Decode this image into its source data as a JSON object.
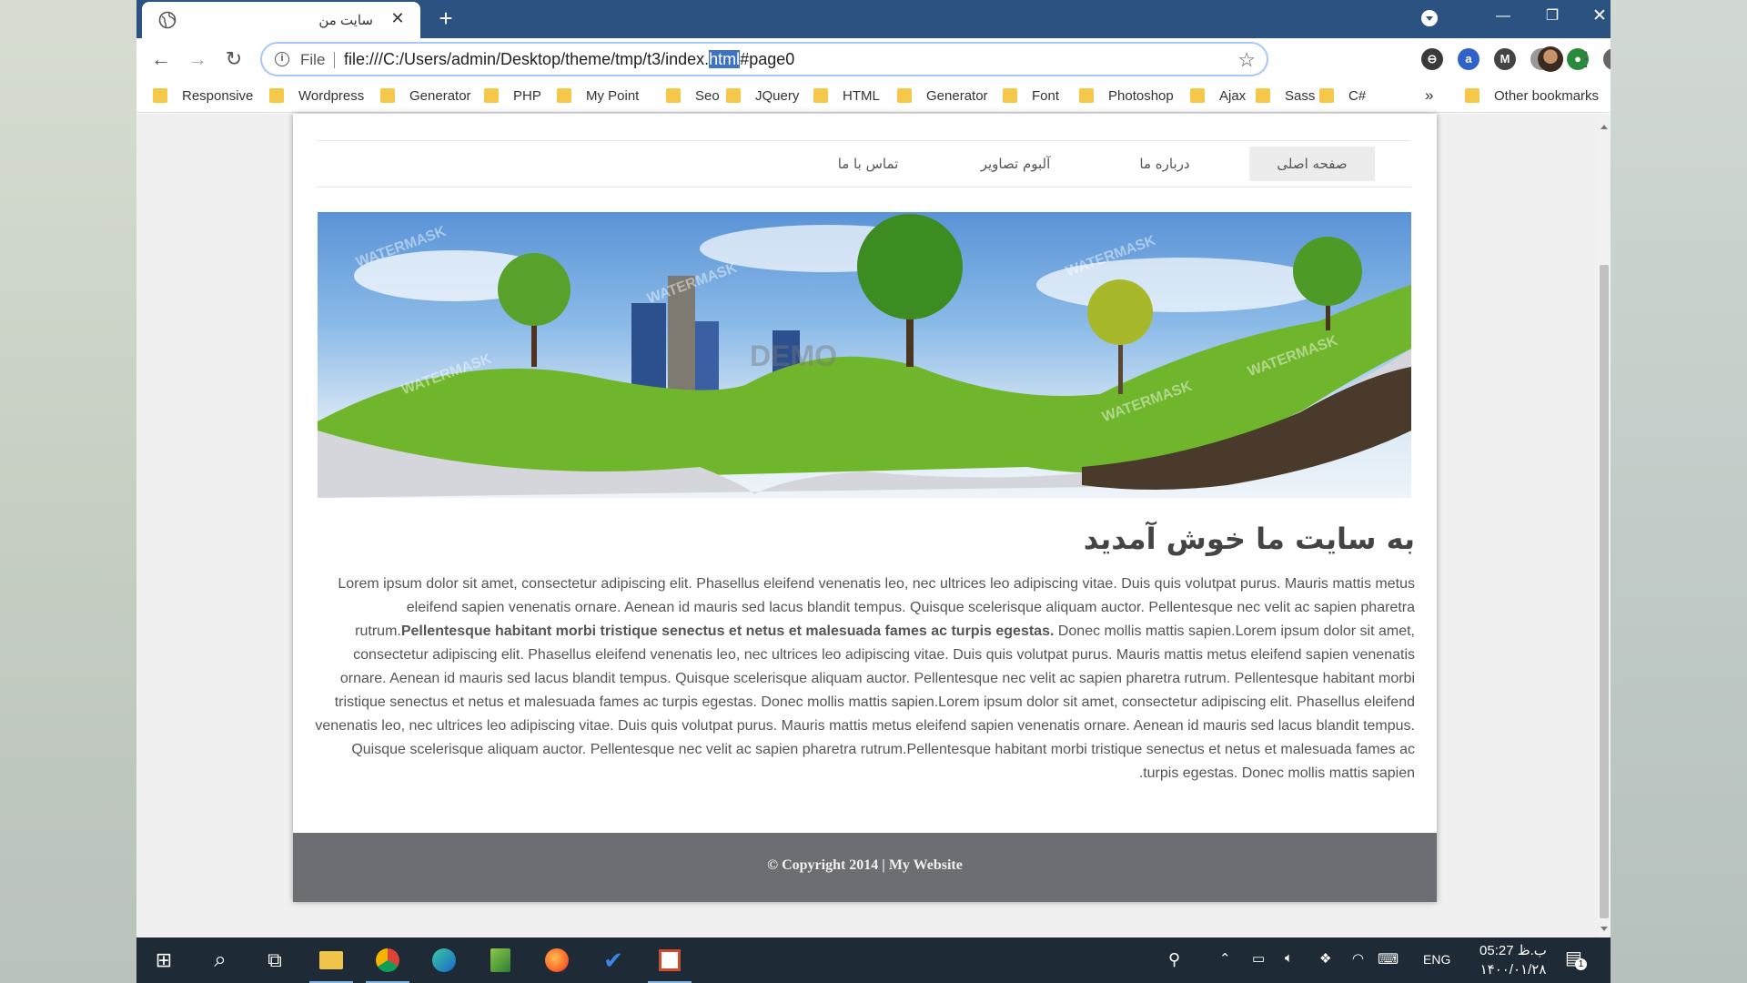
{
  "browser": {
    "tab_title": "سایت من",
    "tab_close": "✕",
    "new_tab": "+",
    "window_controls": {
      "minimize": "—",
      "restore": "❐",
      "close": "✕"
    },
    "nav": {
      "back": "←",
      "forward": "→",
      "reload": "↻"
    },
    "omnibox": {
      "info_icon": "i",
      "scheme_label": "File",
      "url_prefix": "file:///C:/Users/admin/Desktop/theme/tmp/t3/index.",
      "url_selected": "html",
      "url_suffix": "#page0",
      "star": "☆"
    },
    "extensions": [
      {
        "name": "ext-1-icon",
        "glyph": "⊖",
        "color": "#3a3a3a"
      },
      {
        "name": "ext-2-icon",
        "glyph": "a",
        "color": "#2f63c9"
      },
      {
        "name": "gmail-m-icon",
        "glyph": "M",
        "color": "#444"
      },
      {
        "name": "camera-icon",
        "glyph": "◙",
        "color": "#999"
      },
      {
        "name": "globe-ext-icon",
        "glyph": "●",
        "color": "#2a8a3c"
      },
      {
        "name": "c-ext-icon",
        "glyph": "c",
        "color": "#666"
      },
      {
        "name": "puzzle-icon",
        "glyph": "✱",
        "color": "#555"
      }
    ],
    "menu_dots": "⋮",
    "bookmarks": [
      "Responsive",
      "Wordpress",
      "Generator",
      "PHP",
      "My Point",
      "Seo",
      "JQuery",
      "HTML",
      "Generator",
      "Font",
      "Photoshop",
      "Ajax",
      "Sass",
      "C#"
    ],
    "bookmarks_more": "»",
    "other_bookmarks": "Other bookmarks"
  },
  "site": {
    "menu": [
      "صفحه اصلی",
      "درباره ما",
      "آلبوم تصاویر",
      "تماس با ما"
    ],
    "active_menu_index": 0,
    "banner_watermark": "WATERMASK",
    "banner_center_mark": "DEMO",
    "heading": "به سایت ما خوش آمدید",
    "paragraph_part1": "Lorem ipsum dolor sit amet, consectetur adipiscing elit. Phasellus eleifend venenatis leo, nec ultrices leo adipiscing vitae. Duis quis volutpat purus. Mauris mattis metus eleifend sapien venenatis ornare. Aenean id mauris sed lacus blandit tempus. Quisque scelerisque aliquam auctor. Pellentesque nec velit ac sapien pharetra rutrum.",
    "paragraph_bold": "Pellentesque habitant morbi tristique senectus et netus et malesuada fames ac turpis egestas.",
    "paragraph_part2": " Donec mollis mattis sapien.Lorem ipsum dolor sit amet, consectetur adipiscing elit. Phasellus eleifend venenatis leo, nec ultrices leo adipiscing vitae. Duis quis volutpat purus. Mauris mattis metus eleifend sapien venenatis ornare. Aenean id mauris sed lacus blandit tempus. Quisque scelerisque aliquam auctor. Pellentesque nec velit ac sapien pharetra rutrum. Pellentesque habitant morbi tristique senectus et netus et malesuada fames ac turpis egestas. Donec mollis mattis sapien.Lorem ipsum dolor sit amet, consectetur adipiscing elit. Phasellus eleifend venenatis leo, nec ultrices leo adipiscing vitae. Duis quis volutpat purus. Mauris mattis metus eleifend sapien venenatis ornare. Aenean id mauris sed lacus blandit tempus. Quisque scelerisque aliquam auctor. Pellentesque nec velit ac sapien pharetra rutrum.Pellentesque habitant morbi tristique senectus et netus et malesuada fames ac turpis egestas. Donec mollis mattis sapien.",
    "footer": "© Copyright 2014 | My Website"
  },
  "taskbar": {
    "start": "⊞",
    "search": "⌕",
    "task_view": "⧉",
    "apps": [
      "file-explorer",
      "chrome",
      "edge",
      "sheet-app",
      "firefox",
      "todo-check",
      "office-app"
    ],
    "language": "ENG",
    "time": "05:27 ب.ظ",
    "date": "۱۴۰۰/۰۱/۲۸",
    "notification_count": "1"
  }
}
